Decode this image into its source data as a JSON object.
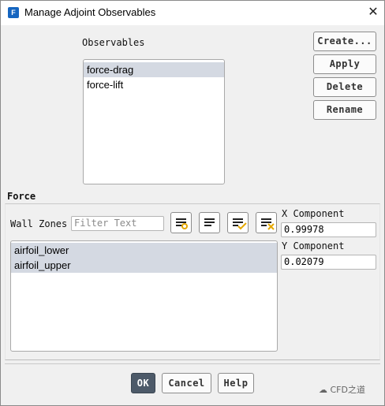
{
  "window": {
    "title": "Manage Adjoint Observables",
    "app_icon_letter": "F"
  },
  "observables": {
    "label": "Observables",
    "items": [
      {
        "label": "force-drag",
        "selected": true
      },
      {
        "label": "force-lift",
        "selected": false
      }
    ]
  },
  "side_buttons": {
    "create": "Create...",
    "apply": "Apply",
    "delete": "Delete",
    "rename": "Rename"
  },
  "force": {
    "group_label": "Force",
    "wall_zones_label": "Wall Zones",
    "filter_placeholder": "Filter Text",
    "zones": [
      {
        "label": "airfoil_lower",
        "selected": true
      },
      {
        "label": "airfoil_upper",
        "selected": true
      }
    ],
    "x_component_label": "X Component",
    "x_component_value": "0.99978",
    "y_component_label": "Y Component",
    "y_component_value": "0.02079"
  },
  "footer": {
    "ok": "OK",
    "cancel": "Cancel",
    "help": "Help"
  },
  "watermark": "CFD之道",
  "colors": {
    "selection": "#d4d9e2",
    "ok_button": "#4d5a69",
    "check_icon": "#e5a800",
    "clear_icon": "#e5a800"
  }
}
